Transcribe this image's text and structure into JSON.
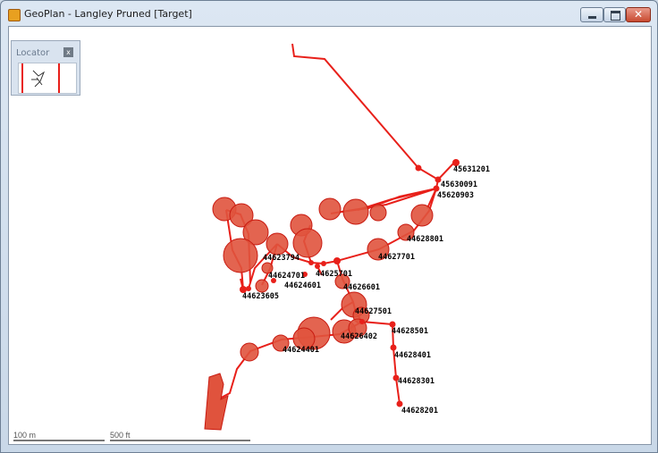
{
  "window": {
    "title": "GeoPlan - Langley Pruned [Target]"
  },
  "locator": {
    "title": "Locator",
    "close_glyph": "x"
  },
  "scale_bars": {
    "metric": "100 m",
    "imperial": "500 ft"
  },
  "node_labels": [
    "45631201",
    "45630091",
    "45620903",
    "44628801",
    "44627701",
    "44623794",
    "44625701",
    "44624701",
    "44624601",
    "44626601",
    "44623605",
    "44627501",
    "44628501",
    "44626402",
    "44624401",
    "44628401",
    "44628301",
    "44628201"
  ],
  "colors": {
    "network": "#e8201a",
    "fill": "#e0533d"
  },
  "icons": {
    "app": "geoplan-app-icon",
    "minimize": "minimize-icon",
    "maximize": "maximize-icon",
    "close": "close-icon"
  }
}
